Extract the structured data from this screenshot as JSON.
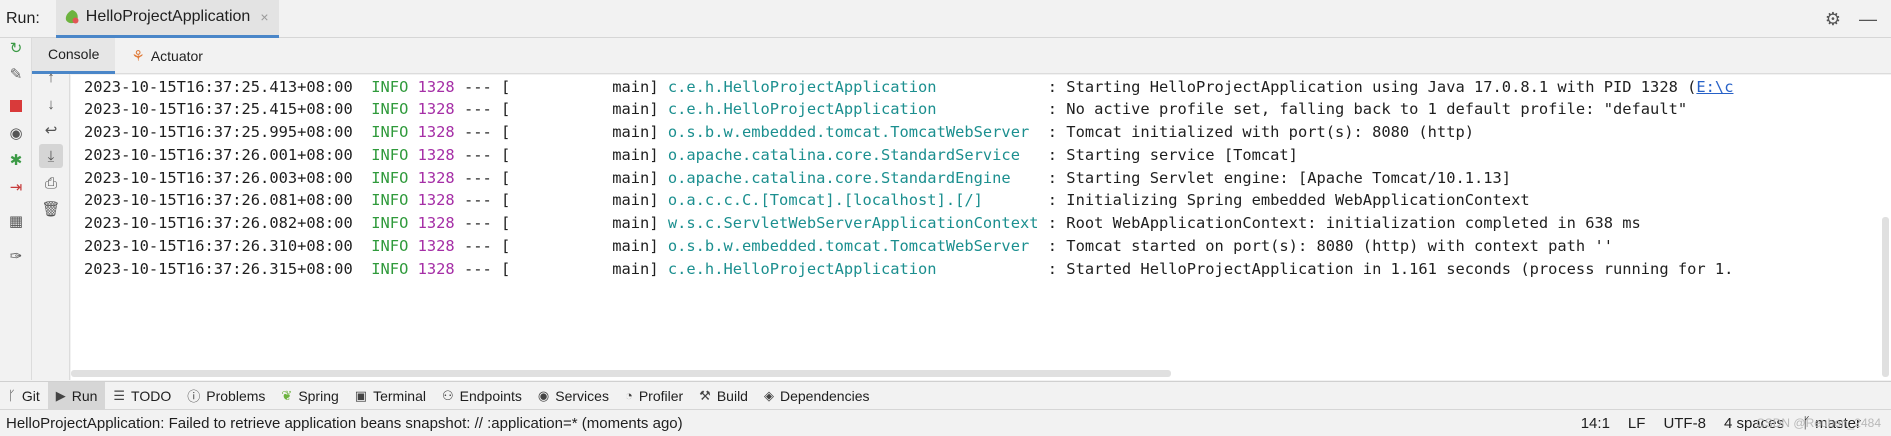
{
  "run_bar": {
    "label": "Run:",
    "tab_title": "HelloProjectApplication",
    "close_glyph": "×",
    "gear_icon": "gear-icon",
    "minimize_icon": "minimize-icon"
  },
  "sub_tabs": [
    {
      "label": "Console",
      "active": true
    },
    {
      "label": "Actuator",
      "active": false
    }
  ],
  "log_lines": [
    {
      "ts": "2023-10-15T16:37:25.413+08:00",
      "level": "INFO",
      "pid": "1328",
      "sep": "--- [",
      "thread": "           main] ",
      "logger": "c.e.h.HelloProjectApplication           ",
      "msg": " : Starting HelloProjectApplication using Java 17.0.8.1 with PID 1328 (",
      "link": "E:\\c"
    },
    {
      "ts": "2023-10-15T16:37:25.415+08:00",
      "level": "INFO",
      "pid": "1328",
      "sep": "--- [",
      "thread": "           main] ",
      "logger": "c.e.h.HelloProjectApplication           ",
      "msg": " : No active profile set, falling back to 1 default profile: \"default\"",
      "link": ""
    },
    {
      "ts": "2023-10-15T16:37:25.995+08:00",
      "level": "INFO",
      "pid": "1328",
      "sep": "--- [",
      "thread": "           main] ",
      "logger": "o.s.b.w.embedded.tomcat.TomcatWebServer ",
      "msg": " : Tomcat initialized with port(s): 8080 (http)",
      "link": ""
    },
    {
      "ts": "2023-10-15T16:37:26.001+08:00",
      "level": "INFO",
      "pid": "1328",
      "sep": "--- [",
      "thread": "           main] ",
      "logger": "o.apache.catalina.core.StandardService  ",
      "msg": " : Starting service [Tomcat]",
      "link": ""
    },
    {
      "ts": "2023-10-15T16:37:26.003+08:00",
      "level": "INFO",
      "pid": "1328",
      "sep": "--- [",
      "thread": "           main] ",
      "logger": "o.apache.catalina.core.StandardEngine   ",
      "msg": " : Starting Servlet engine: [Apache Tomcat/10.1.13]",
      "link": ""
    },
    {
      "ts": "2023-10-15T16:37:26.081+08:00",
      "level": "INFO",
      "pid": "1328",
      "sep": "--- [",
      "thread": "           main] ",
      "logger": "o.a.c.c.C.[Tomcat].[localhost].[/]      ",
      "msg": " : Initializing Spring embedded WebApplicationContext",
      "link": ""
    },
    {
      "ts": "2023-10-15T16:37:26.082+08:00",
      "level": "INFO",
      "pid": "1328",
      "sep": "--- [",
      "thread": "           main] ",
      "logger": "w.s.c.ServletWebServerApplicationContext",
      "msg": " : Root WebApplicationContext: initialization completed in 638 ms",
      "link": ""
    },
    {
      "ts": "2023-10-15T16:37:26.310+08:00",
      "level": "INFO",
      "pid": "1328",
      "sep": "--- [",
      "thread": "           main] ",
      "logger": "o.s.b.w.embedded.tomcat.TomcatWebServer ",
      "msg": " : Tomcat started on port(s): 8080 (http) with context path ''",
      "link": ""
    },
    {
      "ts": "2023-10-15T16:37:26.315+08:00",
      "level": "INFO",
      "pid": "1328",
      "sep": "--- [",
      "thread": "           main] ",
      "logger": "c.e.h.HelloProjectApplication           ",
      "msg": " : Started HelloProjectApplication in 1.161 seconds (process running for 1.",
      "link": ""
    }
  ],
  "tool_window_tabs": [
    {
      "label": "Git",
      "icon": "git-branch-icon",
      "active": false
    },
    {
      "label": "Run",
      "icon": "run-icon",
      "active": true
    },
    {
      "label": "TODO",
      "icon": "todo-list-icon",
      "active": false
    },
    {
      "label": "Problems",
      "icon": "info-icon",
      "active": false
    },
    {
      "label": "Spring",
      "icon": "spring-leaf-icon",
      "active": false
    },
    {
      "label": "Terminal",
      "icon": "terminal-icon",
      "active": false
    },
    {
      "label": "Endpoints",
      "icon": "endpoints-icon",
      "active": false
    },
    {
      "label": "Services",
      "icon": "services-icon",
      "active": false
    },
    {
      "label": "Profiler",
      "icon": "profiler-icon",
      "active": false
    },
    {
      "label": "Build",
      "icon": "build-hammer-icon",
      "active": false
    },
    {
      "label": "Dependencies",
      "icon": "dependencies-icon",
      "active": false
    }
  ],
  "status_bar": {
    "message": "HelloProjectApplication: Failed to retrieve application beans snapshot: // :application=* (moments ago)",
    "position": "14:1",
    "line_sep": "LF",
    "encoding": "UTF-8",
    "indent": "4 spaces",
    "branch": "master",
    "watermark": "CSDN @Reuben_2484"
  }
}
